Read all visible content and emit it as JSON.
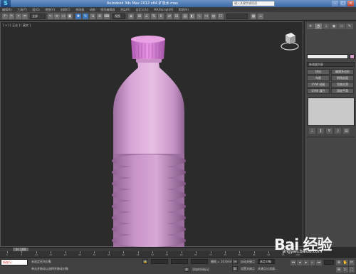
{
  "window": {
    "title": "Autodesk 3ds Max 2012 x64    矿泉水.max",
    "search_placeholder": "键入关键字或短语",
    "buttons": {
      "min": "–",
      "max": "□",
      "close": "✕"
    },
    "logo": "S"
  },
  "menu": [
    "编辑(E)",
    "工具(T)",
    "组(G)",
    "视图(V)",
    "创建(C)",
    "修改器",
    "动画",
    "图形编辑器",
    "渲染(R)",
    "自定义(U)",
    "MAXScript(M)",
    "帮助(H)"
  ],
  "toolbar": {
    "select_filter": "全部",
    "view_dropdown": "视图"
  },
  "viewport": {
    "label": "[ + ] [ 正交 ] [ 真实 ]"
  },
  "command_panel": {
    "modifier_list": "修改器列表",
    "modifier_buttons": [
      "挤出",
      "编辑多边形",
      "车削",
      "倒角剖面",
      "UVW 贴图",
      "弯曲光滑",
      "UVW 展开",
      "涡轮平滑",
      "网格平滑",
      "FFD 4x4x4"
    ]
  },
  "time_slider": {
    "label": "0 / 100"
  },
  "track": {
    "ticks": [
      "0",
      "5",
      "10",
      "15",
      "20",
      "25",
      "30",
      "35",
      "40",
      "45",
      "50",
      "55",
      "60",
      "65",
      "70",
      "75",
      "80",
      "85",
      "90",
      "95",
      "100"
    ]
  },
  "status_bar": {
    "script_label": "所在行:",
    "prompt_line1": "未选定任何对象",
    "prompt_line2": "单击并拖动以选择并移动对象",
    "grid_label": "栅格 = 10.0mm",
    "auto_key": "自动关键点",
    "set_key": "设置关键点",
    "selected": "选定对象",
    "key_filters": "关键点过滤器...",
    "add_time_tag": "添加时间标记"
  },
  "watermark": {
    "logo": "Bai 经验",
    "url": "jingyan.baidu.com"
  },
  "colors": {
    "bottle": "#d9a5d6",
    "viewport_bg": "#2b2b2b",
    "panel_bg": "#464646"
  }
}
